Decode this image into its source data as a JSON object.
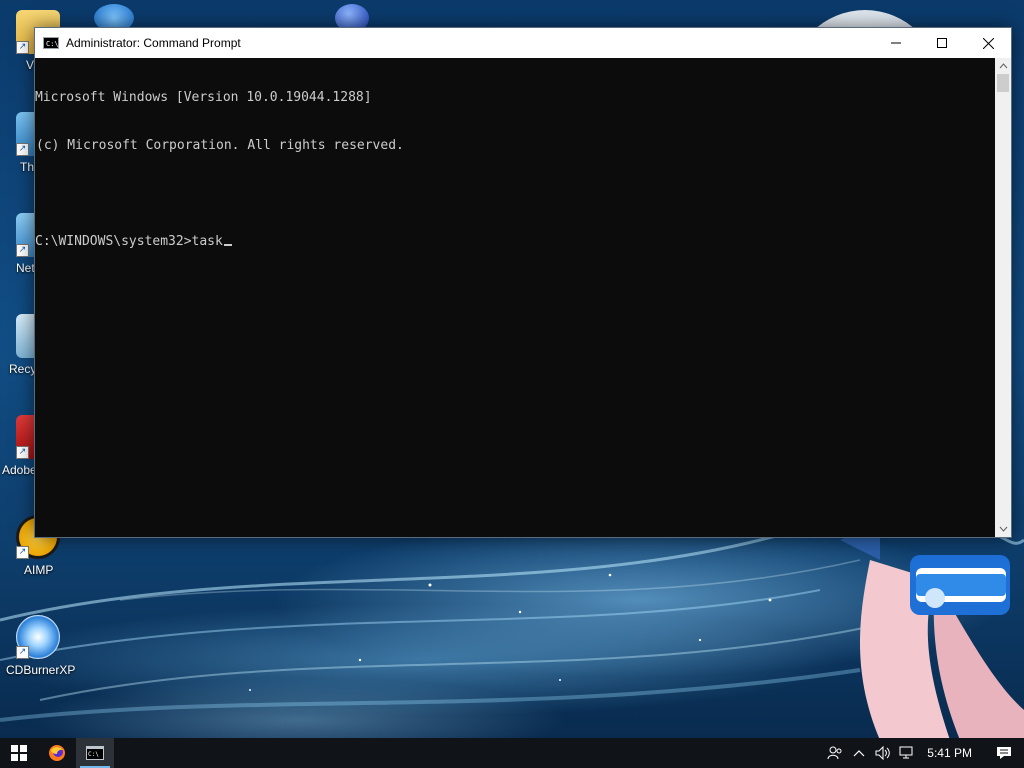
{
  "desktop": {
    "icons": [
      {
        "label": "V",
        "icon": "folder-icon"
      },
      {
        "label": "Thi",
        "icon": "this-pc-icon"
      },
      {
        "label": "Net",
        "icon": "network-icon"
      },
      {
        "label": "Recy",
        "icon": "recycle-bin-icon"
      },
      {
        "label": "Adobe",
        "icon": "adobe-reader-icon"
      },
      {
        "label": "AIMP",
        "icon": "aimp-icon"
      },
      {
        "label": "CDBurnerXP",
        "icon": "cdburnerxp-icon"
      }
    ]
  },
  "window": {
    "title": "Administrator: Command Prompt",
    "icon": "cmd-icon",
    "console_lines": [
      "Microsoft Windows [Version 10.0.19044.1288]",
      "(c) Microsoft Corporation. All rights reserved.",
      "",
      "C:\\WINDOWS\\system32>task"
    ],
    "buttons": {
      "minimize": "minimize-icon",
      "maximize": "maximize-icon",
      "close": "close-icon"
    }
  },
  "taskbar": {
    "apps": [
      {
        "name": "start",
        "icon": "windows-logo-icon"
      },
      {
        "name": "firefox",
        "icon": "firefox-icon"
      },
      {
        "name": "command-prompt",
        "icon": "cmd-icon",
        "active": true
      }
    ],
    "tray": [
      "people-icon",
      "chevron-up-icon",
      "volume-icon",
      "network-icon"
    ],
    "clock": "5:41 PM",
    "notifications": "action-center-icon"
  },
  "colors": {
    "console_bg": "#0c0c0c",
    "console_fg": "#cccccc",
    "taskbar_bg": "#101418",
    "accent": "#76b9ed"
  }
}
